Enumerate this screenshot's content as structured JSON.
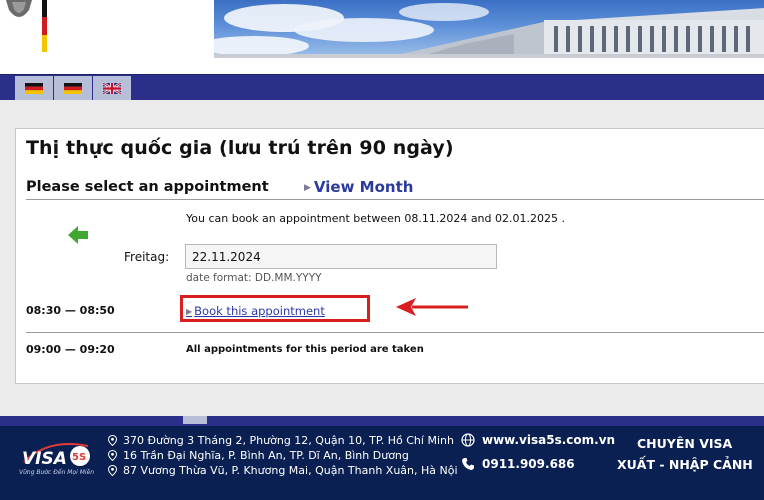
{
  "header": {
    "flags": [
      {
        "name": "germany-flag-icon"
      },
      {
        "name": "germany-flag-icon"
      },
      {
        "name": "uk-flag-icon"
      }
    ]
  },
  "page": {
    "title": "Thị thực quốc gia (lưu trú trên 90 ngày)",
    "subheader": "Please select an appointment",
    "view_month_label": "View Month",
    "info_text": "You can book an appointment between 08.11.2024 and 02.01.2025 .",
    "date_label": "Freitag:",
    "date_value": "22.11.2024",
    "date_hint": "date format: DD.MM.YYYY"
  },
  "slots": [
    {
      "time": "08:30 — 08:50",
      "action": "Book this appointment"
    },
    {
      "time": "09:00 — 09:20",
      "status": "All appointments for this period are taken"
    }
  ],
  "footer": {
    "logo_text": "VISA",
    "logo_badge": "5S",
    "tagline": "Vững Bước Đến Mọi Miền",
    "addresses": [
      "370 Đường 3 Tháng 2, Phường 12, Quận 10, TP. Hồ Chí Minh",
      "16 Trần Đại Nghĩa, P. Bình An, TP. Dĩ An, Bình Dương",
      "87 Vương Thừa Vũ, P. Khương Mai, Quận Thanh Xuân, Hà Nội"
    ],
    "website": "www.visa5s.com.vn",
    "phone": "0911.909.686",
    "slogan_line1": "CHUYÊN VISA",
    "slogan_line2": "XUẤT - NHẬP CẢNH"
  },
  "colors": {
    "nav_blue": "#2b2f8a",
    "link_blue": "#2b3aa8",
    "highlight_red": "#d81e1e",
    "back_arrow_green": "#3fa832",
    "footer_navy": "#0a2052"
  }
}
